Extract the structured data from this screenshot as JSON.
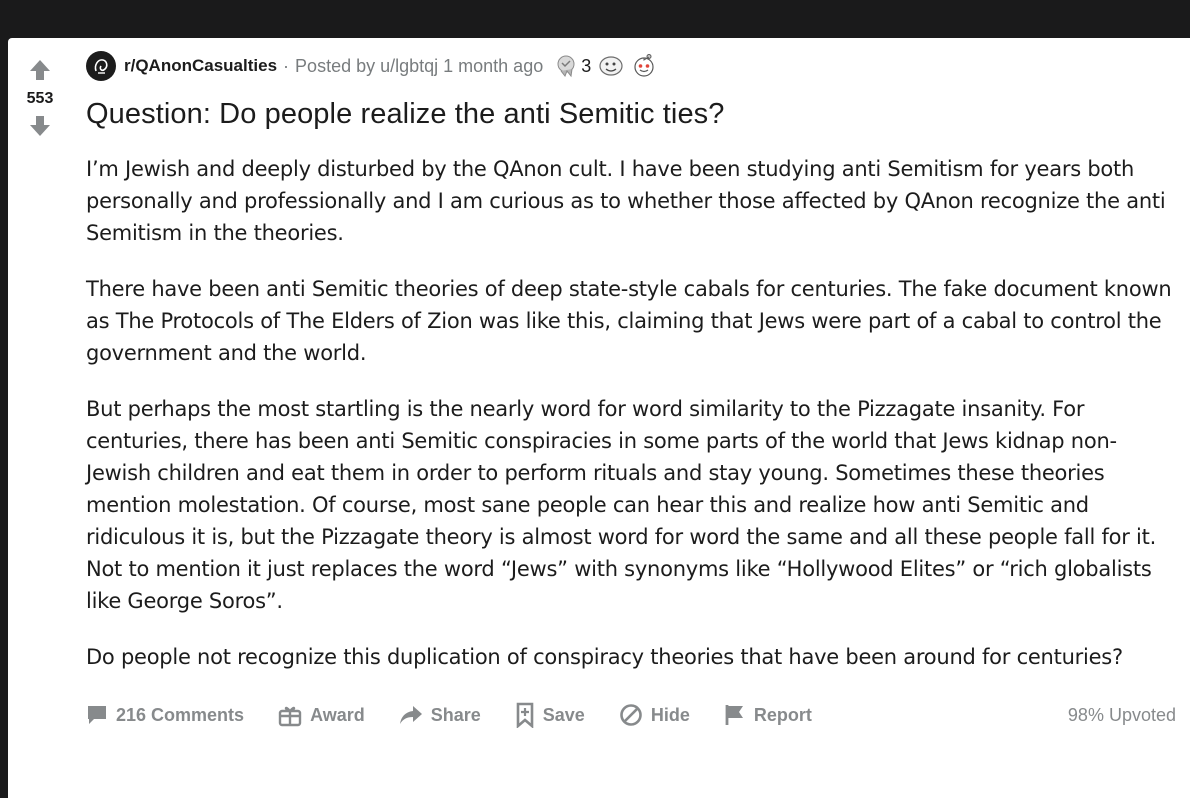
{
  "post": {
    "vote_count": "553",
    "subreddit": "r/QAnonCasualties",
    "separator": "·",
    "posted_by": "Posted by u/lgbtqj 1 month ago",
    "award_count": "3",
    "title": "Question: Do people realize the anti Semitic ties?",
    "paragraphs": [
      "I’m Jewish and deeply disturbed by the QAnon cult. I have been studying anti Semitism for years both personally and professionally and I am curious as to whether those affected by QAnon recognize the anti Semitism in the theories.",
      "There have been anti Semitic theories of deep state-style cabals for centuries. The fake document known as The Protocols of The Elders of Zion was like this, claiming that Jews were part of a cabal to control the government and the world.",
      "But perhaps the most startling is the nearly word for word similarity to the Pizzagate insanity. For centuries, there has been anti Semitic conspiracies in some parts of the world that Jews kidnap non-Jewish children and eat them in order to perform rituals and stay young. Sometimes these theories mention molestation. Of course, most sane people can hear this and realize how anti Semitic and ridiculous it is, but the Pizzagate theory is almost word for word the same and all these people fall for it. Not to mention it just replaces the word “Jews” with synonyms like “Hollywood Elites” or “rich globalists like George Soros”.",
      "Do people not recognize this duplication of conspiracy theories that have been around for centuries?"
    ]
  },
  "actions": {
    "comments": "216 Comments",
    "award": "Award",
    "share": "Share",
    "save": "Save",
    "hide": "Hide",
    "report": "Report",
    "upvoted": "98% Upvoted"
  },
  "colors": {
    "background": "#1a1a1b",
    "card": "#ffffff",
    "muted": "#878a8c",
    "text": "#1c1c1c"
  },
  "icons": [
    "upvote-arrow-icon",
    "downvote-arrow-icon",
    "subreddit-avatar-icon",
    "silver-award-icon",
    "wholesome-award-icon",
    "snoo-award-icon",
    "comment-icon",
    "gift-icon",
    "share-arrow-icon",
    "bookmark-icon",
    "hide-icon",
    "flag-icon"
  ]
}
